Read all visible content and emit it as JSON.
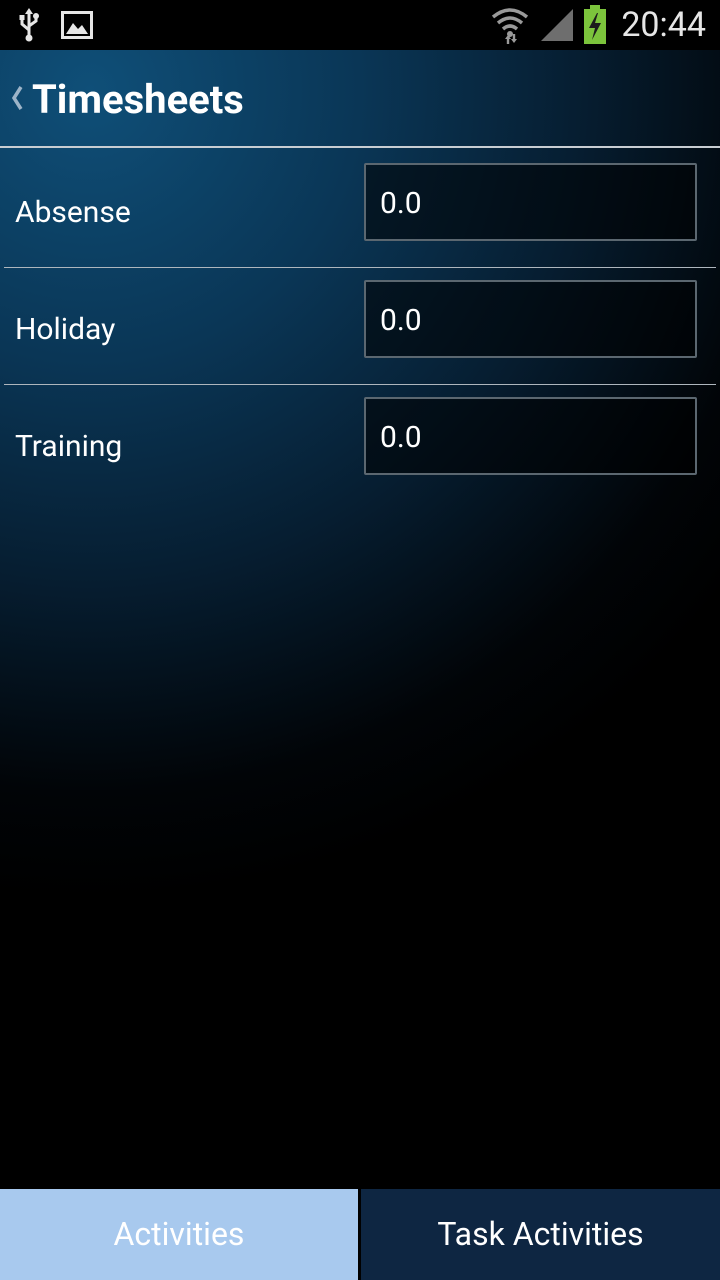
{
  "status_bar": {
    "time": "20:44",
    "icons": [
      "usb-icon",
      "image-icon",
      "wifi-icon",
      "signal-icon",
      "battery-charging-icon"
    ]
  },
  "header": {
    "title": "Timesheets",
    "back_icon": "chevron-left-icon"
  },
  "rows": [
    {
      "label": "Absense",
      "value": "0.0"
    },
    {
      "label": "Holiday",
      "value": "0.0"
    },
    {
      "label": "Training",
      "value": "0.0"
    }
  ],
  "tabs": {
    "activities": "Activities",
    "task_activities": "Task Activities"
  },
  "colors": {
    "tab_active": "#a8c9ee",
    "tab_inactive": "#0e2642",
    "battery": "#7cc43c"
  }
}
